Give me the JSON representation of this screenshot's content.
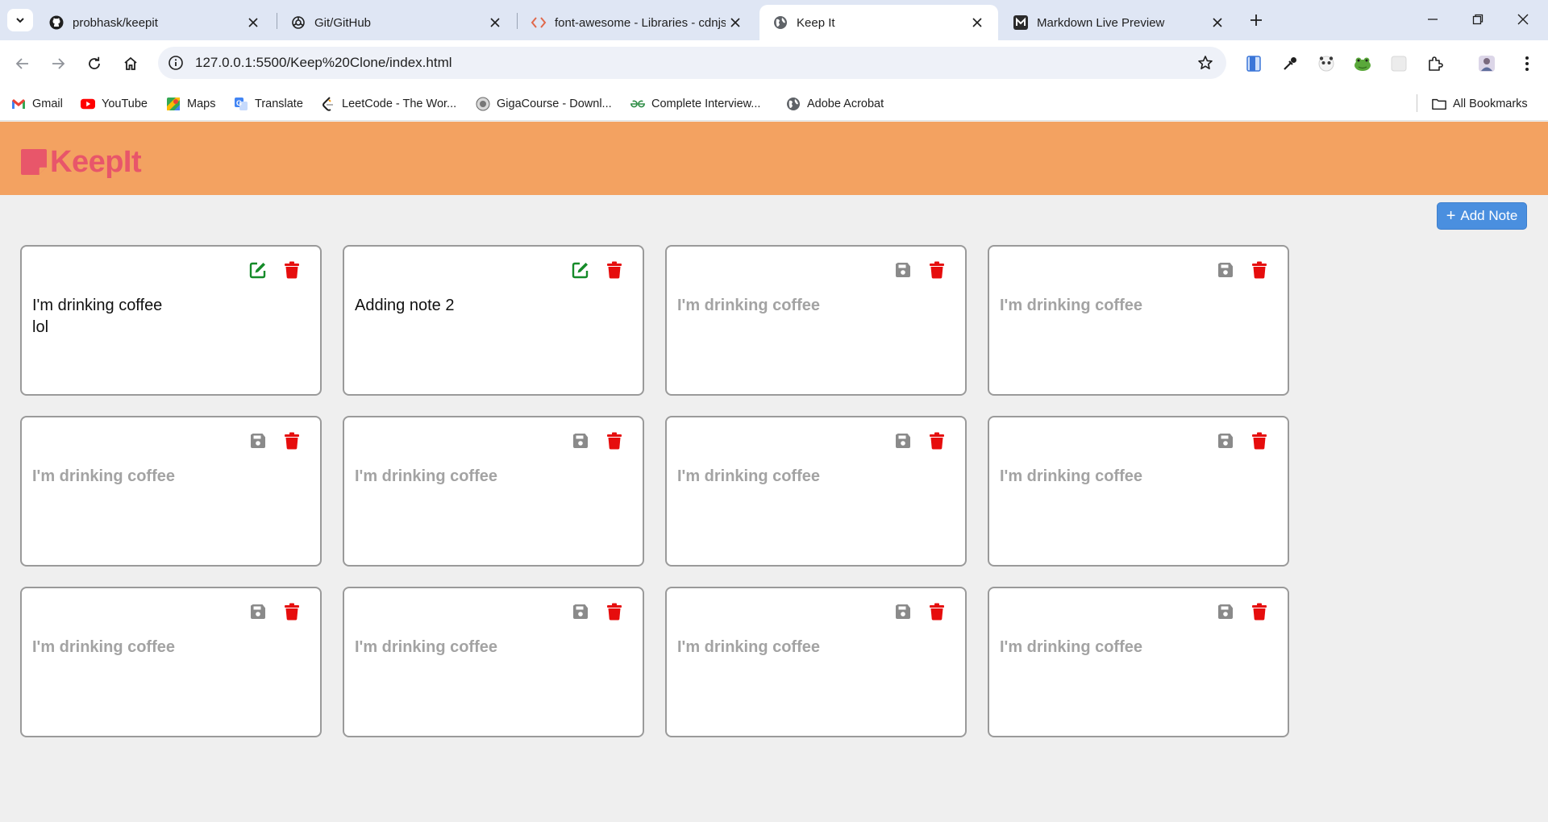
{
  "browser": {
    "tabs": [
      {
        "title": "probhask/keepit",
        "active": false
      },
      {
        "title": "Git/GitHub",
        "active": false
      },
      {
        "title": "font-awesome - Libraries - cdnjs",
        "active": false
      },
      {
        "title": "Keep It",
        "active": true
      },
      {
        "title": "Markdown Live Preview",
        "active": false
      }
    ],
    "url": "127.0.0.1:5500/Keep%20Clone/index.html",
    "bookmarks": [
      {
        "label": "Gmail",
        "icon": "gmail-icon"
      },
      {
        "label": "YouTube",
        "icon": "youtube-icon"
      },
      {
        "label": "Maps",
        "icon": "maps-icon"
      },
      {
        "label": "Translate",
        "icon": "translate-icon"
      },
      {
        "label": "LeetCode - The Wor...",
        "icon": "leetcode-icon"
      },
      {
        "label": "GigaCourse - Downl...",
        "icon": "gigacourse-icon"
      },
      {
        "label": "Complete Interview...",
        "icon": "geeksforgeeks-icon"
      },
      {
        "label": "Adobe Acrobat",
        "icon": "globe-icon"
      }
    ],
    "all_bookmarks": "All Bookmarks"
  },
  "app": {
    "logo_text": "KeepIt",
    "brand_color": "#f3a261",
    "logo_color": "#e8566a",
    "add_note_label": "Add Note"
  },
  "notes": [
    {
      "text": "I'm drinking coffee\nlol",
      "mode": "saved"
    },
    {
      "text": "Adding note 2",
      "mode": "saved"
    },
    {
      "placeholder": "I'm drinking coffee",
      "mode": "editing"
    },
    {
      "placeholder": "I'm drinking coffee",
      "mode": "editing"
    },
    {
      "placeholder": "I'm drinking coffee",
      "mode": "editing"
    },
    {
      "placeholder": "I'm drinking coffee",
      "mode": "editing"
    },
    {
      "placeholder": "I'm drinking coffee",
      "mode": "editing"
    },
    {
      "placeholder": "I'm drinking coffee",
      "mode": "editing"
    },
    {
      "placeholder": "I'm drinking coffee",
      "mode": "editing"
    },
    {
      "placeholder": "I'm drinking coffee",
      "mode": "editing"
    },
    {
      "placeholder": "I'm drinking coffee",
      "mode": "editing"
    },
    {
      "placeholder": "I'm drinking coffee",
      "mode": "editing"
    }
  ],
  "icon_colors": {
    "edit": "#158b29",
    "delete": "#e60d0d",
    "save": "#8a8a8a"
  }
}
